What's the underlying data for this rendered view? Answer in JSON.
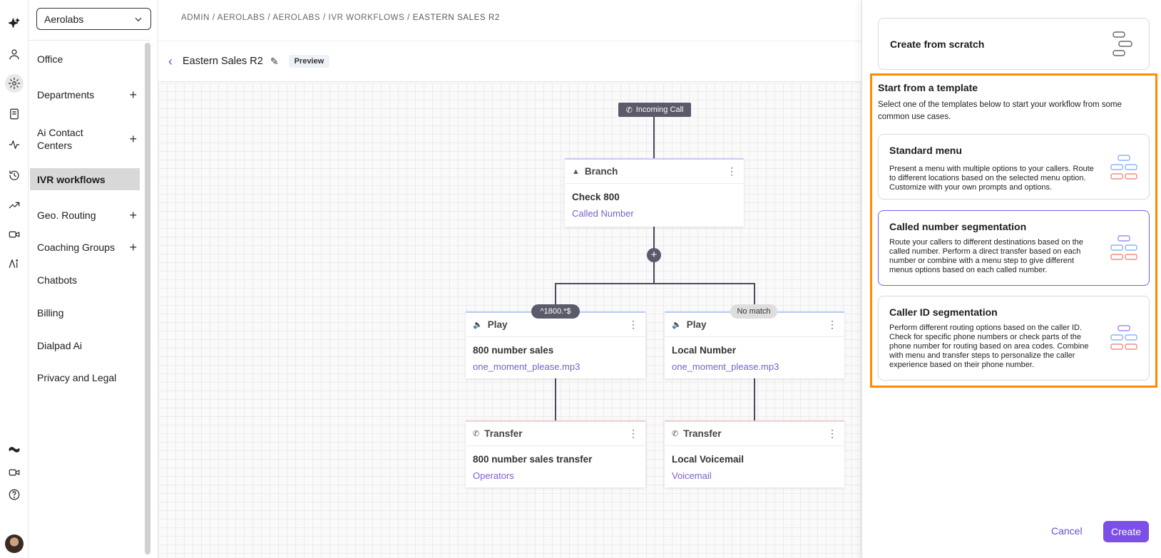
{
  "sidebar": {
    "org": "Aerolabs",
    "items": [
      {
        "label": "Office"
      },
      {
        "label": "Departments"
      },
      {
        "label": "Ai Contact Centers"
      },
      {
        "label": "IVR workflows"
      },
      {
        "label": "Geo. Routing"
      },
      {
        "label": "Coaching Groups"
      },
      {
        "label": "Chatbots"
      },
      {
        "label": "Billing"
      },
      {
        "label": "Dialpad Ai"
      },
      {
        "label": "Privacy and Legal"
      }
    ]
  },
  "breadcrumb": {
    "path": "ADMIN / AEROLABS / AEROLABS / IVR WORKFLOWS / ",
    "current": "EASTERN SALES R2"
  },
  "header": {
    "title": "Eastern Sales R2",
    "badge": "Preview"
  },
  "flow": {
    "incoming": "Incoming Call",
    "branch": {
      "type": "Branch",
      "title": "Check 800",
      "sub": "Called Number"
    },
    "pill_left": "^1800.*$",
    "pill_right": "No match",
    "play_left": {
      "type": "Play",
      "title": "800 number sales",
      "sub": "one_moment_please.mp3"
    },
    "play_right": {
      "type": "Play",
      "title": "Local Number",
      "sub": "one_moment_please.mp3"
    },
    "transfer_left": {
      "type": "Transfer",
      "title": "800 number sales transfer",
      "sub": "Operators"
    },
    "transfer_right": {
      "type": "Transfer",
      "title": "Local Voicemail",
      "sub": "Voicemail"
    }
  },
  "panel": {
    "scratch": "Create from scratch",
    "heading": "Start from a template",
    "description": "Select one of the templates below to start your workflow from some common use cases.",
    "templates": [
      {
        "title": "Standard menu",
        "body": "Present a menu with multiple options to your callers. Route to different locations based on the selected menu option. Customize with your own prompts and options."
      },
      {
        "title": "Called number segmentation",
        "body": "Route your callers to different destinations based on the called number. Perform a direct transfer based on each number or combine with a menu step to give different menus options based on each called number."
      },
      {
        "title": "Caller ID segmentation",
        "body": "Perform different routing options based on the caller ID. Check for specific phone numbers or check parts of the phone number for routing based on area codes. Combine with menu and transfer steps to personalize the caller experience based on their phone number."
      }
    ],
    "cancel": "Cancel",
    "create": "Create"
  },
  "colors": {
    "accent": "#7b4fe8",
    "highlight": "#ff8c00",
    "link": "#7a60c9"
  }
}
